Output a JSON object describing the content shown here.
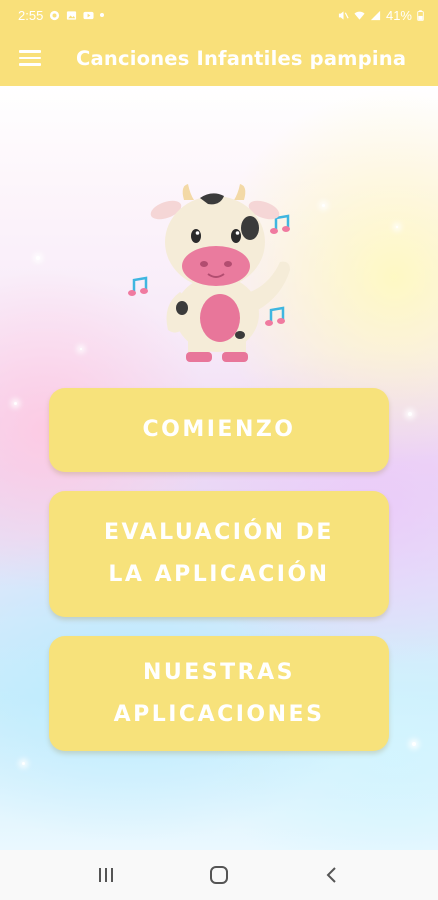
{
  "status_bar": {
    "time": "2:55",
    "battery": "41%",
    "icons": [
      "whatsapp-icon",
      "gallery-icon",
      "youtube-icon",
      "dot-icon",
      "mute-icon",
      "wifi-icon",
      "signal-icon",
      "battery-icon"
    ]
  },
  "app_bar": {
    "title": "Canciones Infantiles pampina",
    "menu_icon": "hamburger-menu-icon"
  },
  "colors": {
    "accent": "#f9e07a",
    "button": "#f7e27b",
    "button_text": "#ffffff"
  },
  "illustration": {
    "name": "cow-mascot",
    "decorations": [
      "music-note-icon",
      "music-note-icon",
      "music-note-icon"
    ]
  },
  "buttons": {
    "start": "COMIENZO",
    "rate_line1": "EVALUACIÓN DE",
    "rate_line2": "LA APLICACIÓN",
    "apps_line1": "NUESTRAS",
    "apps_line2": "APLICACIONES"
  },
  "nav_bar": {
    "items": [
      "recent-apps-icon",
      "home-icon",
      "back-icon"
    ]
  }
}
